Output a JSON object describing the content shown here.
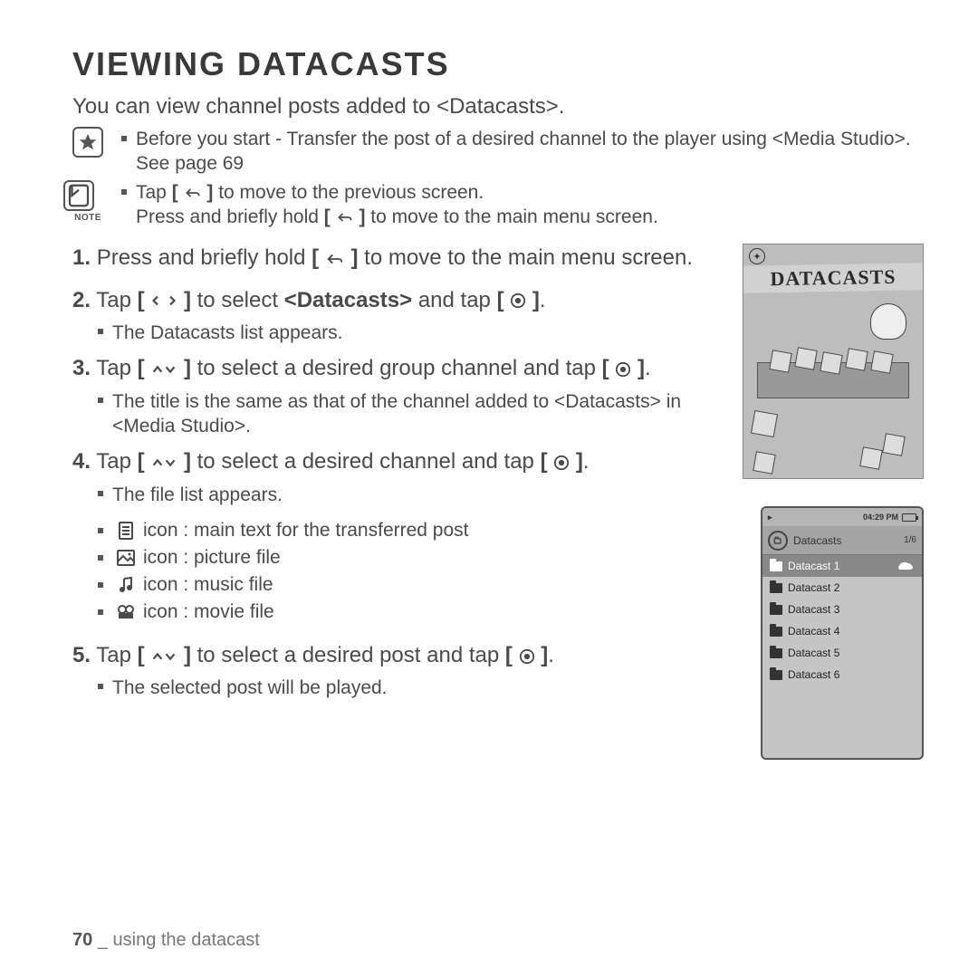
{
  "heading": "VIEWING DATACASTS",
  "intro": "You can view channel posts added to <Datacasts>.",
  "callout_star": "Before you start - Transfer the post of a desired channel to the player using <Media Studio>. See page 69",
  "callout_note_1": "to move to the previous screen.",
  "callout_note_2": "to move to the main menu screen.",
  "note_tap_prefix": "Tap",
  "note_press_prefix": "Press and briefly hold",
  "note_label": "NOTE",
  "steps": {
    "s1_a": "1.",
    "s1_b": "Press and briefly hold",
    "s1_c": "to move to the main menu screen.",
    "s2_a": "2.",
    "s2_b": "Tap",
    "s2_c": "to select",
    "s2_d": "<Datacasts>",
    "s2_e": "and tap",
    "s2_sub": "The Datacasts list appears.",
    "s3_a": "3.",
    "s3_b": "Tap",
    "s3_c": "to select a desired group channel and tap",
    "s3_sub": "The title is the same as that of the channel added to <Datacasts> in <Media Studio>.",
    "s4_a": "4.",
    "s4_b": "Tap",
    "s4_c": "to select a desired channel and tap",
    "s4_sub": "The file list appears.",
    "s5_a": "5.",
    "s5_b": "Tap",
    "s5_c": "to select a desired post and tap",
    "s5_sub": "The selected post will be played."
  },
  "icon_list": {
    "text": "icon : main text for the transferred post",
    "picture": "icon : picture file",
    "music": "icon : music file",
    "movie": "icon : movie file"
  },
  "illus_title": "DATACASTS",
  "device": {
    "time": "04:29 PM",
    "header": "Datacasts",
    "counter": "1/6",
    "rows": [
      "Datacast 1",
      "Datacast 2",
      "Datacast 3",
      "Datacast 4",
      "Datacast 5",
      "Datacast 6"
    ]
  },
  "footer_page": "70",
  "footer_sep": "_",
  "footer_text": "using the datacast"
}
